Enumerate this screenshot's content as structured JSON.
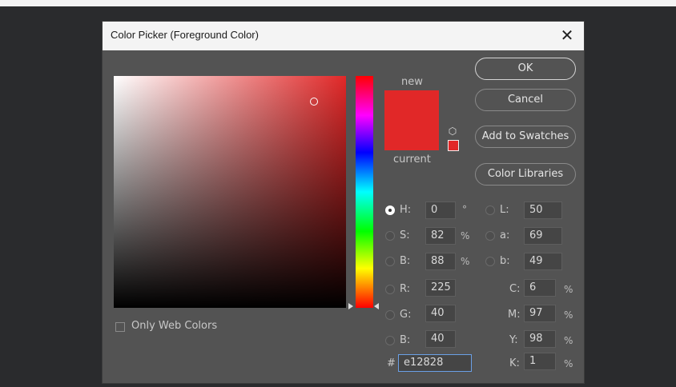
{
  "window": {
    "title": "Color Picker (Foreground Color)",
    "close_glyph": "✕"
  },
  "swatches": {
    "new_label": "new",
    "current_label": "current",
    "new_color": "#e12828",
    "current_color": "#e12828"
  },
  "buttons": {
    "ok": "OK",
    "cancel": "Cancel",
    "add_to_swatches": "Add to Swatches",
    "color_libraries": "Color Libraries"
  },
  "hsb": {
    "h": {
      "label": "H:",
      "value": "0",
      "unit": "°",
      "selected": true
    },
    "s": {
      "label": "S:",
      "value": "82",
      "unit": "%"
    },
    "b": {
      "label": "B:",
      "value": "88",
      "unit": "%"
    }
  },
  "rgb": {
    "r": {
      "label": "R:",
      "value": "225"
    },
    "g": {
      "label": "G:",
      "value": "40"
    },
    "b": {
      "label": "B:",
      "value": "40"
    }
  },
  "lab": {
    "l": {
      "label": "L:",
      "value": "50"
    },
    "a": {
      "label": "a:",
      "value": "69"
    },
    "b": {
      "label": "b:",
      "value": "49"
    }
  },
  "cmyk": {
    "c": {
      "label": "C:",
      "value": "6",
      "unit": "%"
    },
    "m": {
      "label": "M:",
      "value": "97",
      "unit": "%"
    },
    "y": {
      "label": "Y:",
      "value": "98",
      "unit": "%"
    },
    "k": {
      "label": "K:",
      "value": "1",
      "unit": "%"
    }
  },
  "hex": {
    "prefix": "#",
    "value": "e12828"
  },
  "options": {
    "only_web_colors": "Only Web Colors"
  },
  "icons": {
    "cube": "cube-icon",
    "close": "close-icon"
  }
}
